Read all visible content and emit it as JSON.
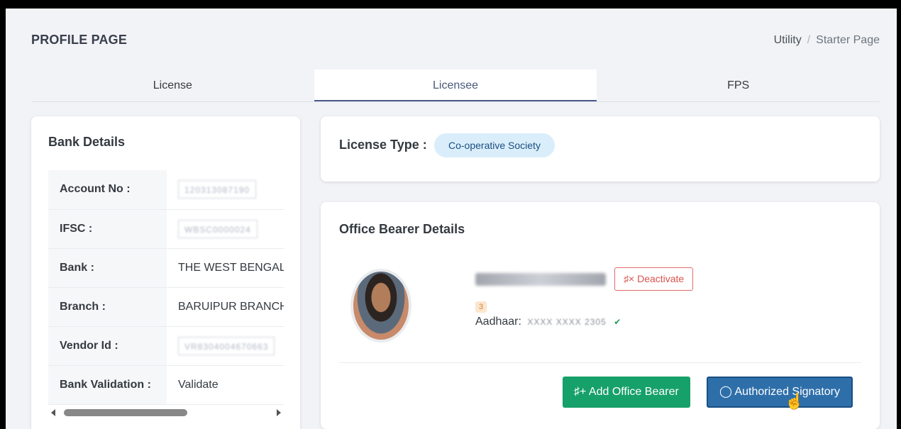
{
  "page": {
    "title": "PROFILE PAGE",
    "breadcrumb": [
      "Utility",
      "Starter Page"
    ],
    "breadcrumb_separator": "/"
  },
  "tabs": [
    {
      "label": "License",
      "active": false
    },
    {
      "label": "Licensee",
      "active": true
    },
    {
      "label": "FPS",
      "active": false
    }
  ],
  "bank_details": {
    "title": "Bank Details",
    "rows": [
      {
        "label": "Account No :",
        "value": "120313087190"
      },
      {
        "label": "IFSC :",
        "value": "WBSC0000024"
      },
      {
        "label": "Bank :",
        "value": "THE WEST BENGAL S"
      },
      {
        "label": "Branch :",
        "value": "BARUIPUR BRANCH"
      },
      {
        "label": "Vendor Id :",
        "value": "VR8304004670663"
      },
      {
        "label": "Bank Validation :",
        "value": "Validate"
      }
    ]
  },
  "license": {
    "label": "License Type :",
    "type": "Co-operative Society"
  },
  "office_bearer": {
    "title": "Office Bearer Details",
    "deactivate_label": "Deactivate",
    "deactivate_icon": "user-x-icon",
    "badge_count": "3",
    "aadhaar_label": "Aadhaar:",
    "aadhaar_value": "XXXX XXXX 2305",
    "add_button": "Add Office Bearer",
    "add_icon": "user-plus-icon",
    "auth_button": "Authorized Signatory",
    "auth_icon": "shield-check-icon"
  },
  "colors": {
    "accent": "#4a5a8c",
    "add_button": "#16a06a",
    "auth_button": "#2e6faa",
    "deactivate": "#d9534f",
    "badge_bg": "#d9eefa"
  }
}
